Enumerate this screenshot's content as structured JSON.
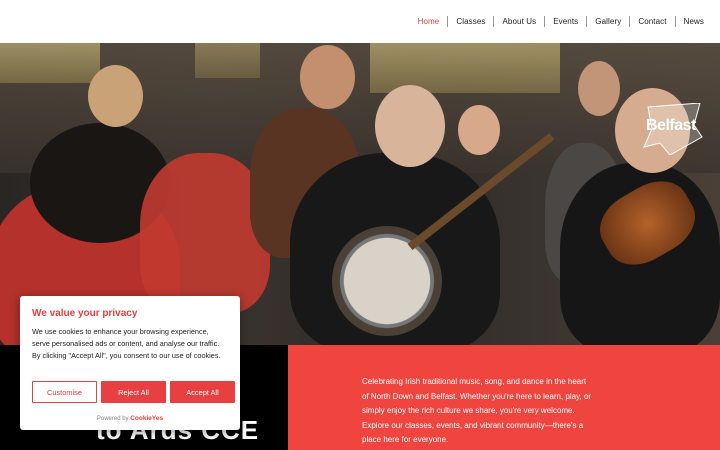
{
  "nav": {
    "items": [
      {
        "label": "Home",
        "active": true
      },
      {
        "label": "Classes",
        "active": false
      },
      {
        "label": "About Us",
        "active": false
      },
      {
        "label": "Events",
        "active": false
      },
      {
        "label": "Gallery",
        "active": false
      },
      {
        "label": "Contact",
        "active": false
      },
      {
        "label": "News",
        "active": false
      }
    ]
  },
  "hero": {
    "logo_text": "Belfast"
  },
  "intro": {
    "heading": "to Ards CCE",
    "text": "Celebrating Irish traditional music, song, and dance in the heart of North Down and Belfast. Whether you're here to learn, play, or simply enjoy the rich culture we share, you're very welcome. Explore our classes, events, and vibrant community—there's a place here for everyone."
  },
  "cookie": {
    "title": "We value your privacy",
    "body": "We use cookies to enhance your browsing experience, serve personalised ads or content, and analyse our traffic. By clicking \"Accept All\", you consent to our use of cookies.",
    "buttons": {
      "customise": "Customise",
      "reject": "Reject All",
      "accept": "Accept All"
    },
    "powered_by": "Powered by",
    "brand": "CookieYes"
  },
  "colors": {
    "accent": "#e84040",
    "red_panel": "#f0443f",
    "dark_panel": "#000000"
  }
}
